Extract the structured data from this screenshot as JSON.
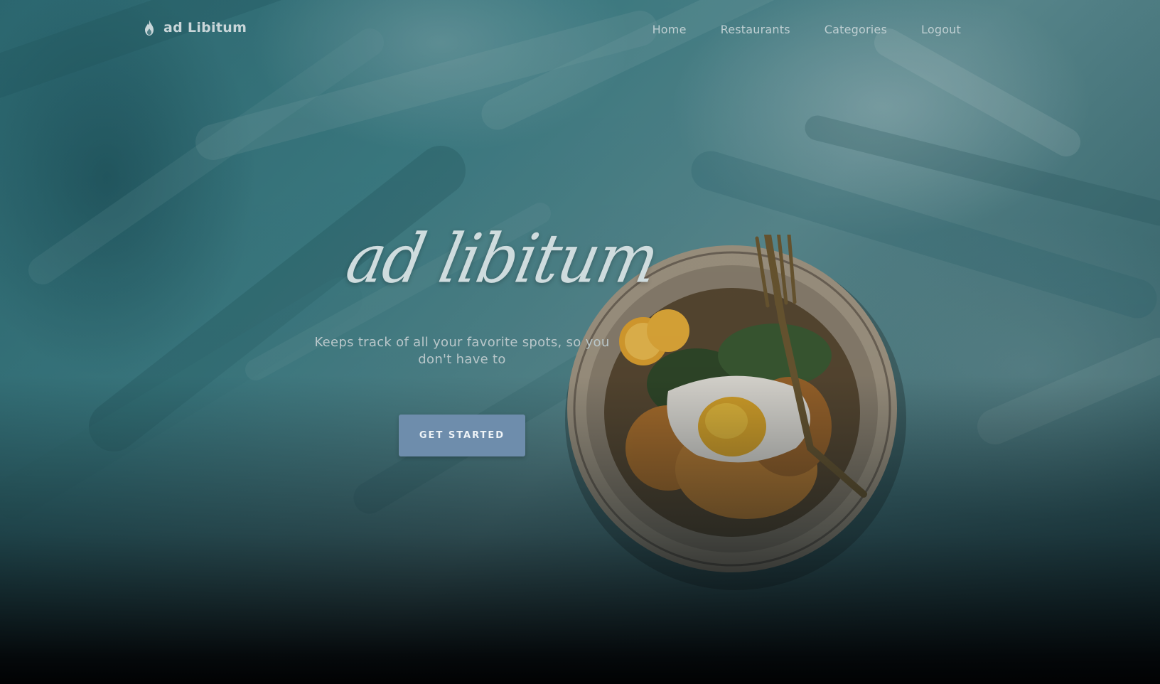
{
  "navbar": {
    "brand_name": "ad Libitum",
    "brand_icon": "flame-icon",
    "links": [
      {
        "label": "Home"
      },
      {
        "label": "Restaurants"
      },
      {
        "label": "Categories"
      },
      {
        "label": "Logout"
      }
    ]
  },
  "hero": {
    "title": "ad libitum",
    "tagline": "Keeps track of all your favorite spots, so you don't have to",
    "cta_label": "GET STARTED",
    "image": "food-plate-egg-noodles"
  },
  "colors": {
    "accent": "#6e8dac",
    "background_teal": "#3e8189",
    "text_light": "#c9d6d9"
  }
}
